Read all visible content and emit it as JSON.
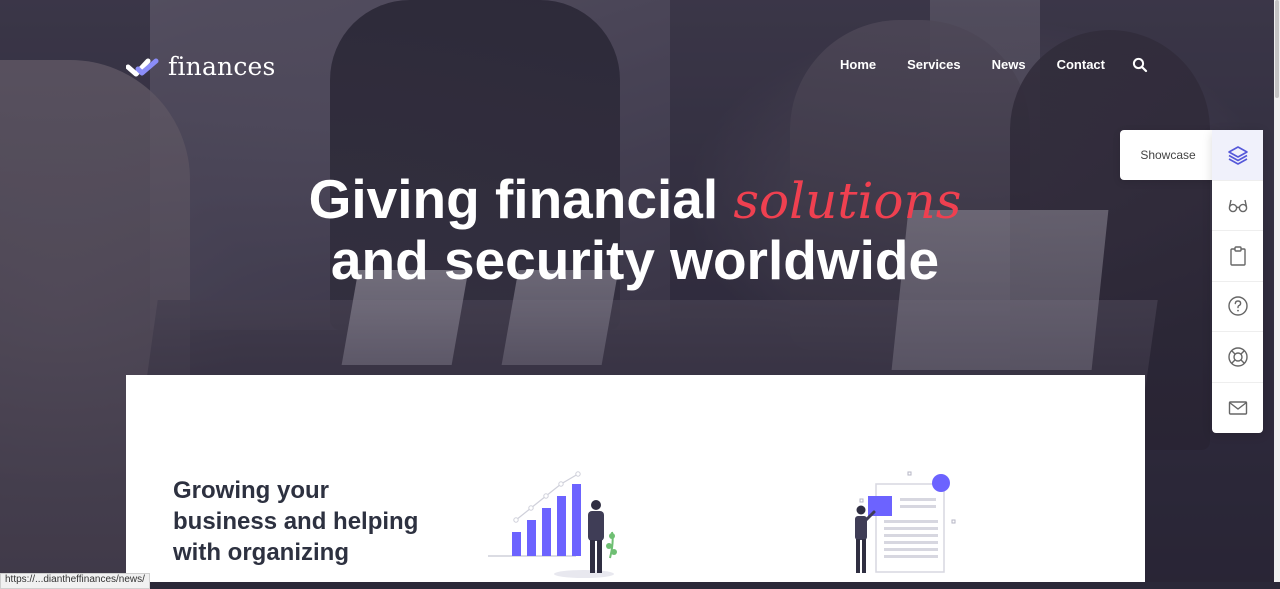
{
  "brand": {
    "name": "finances"
  },
  "nav": {
    "items": [
      "Home",
      "Services",
      "News",
      "Contact"
    ]
  },
  "hero": {
    "line1_before": "Giving financial ",
    "line1_accent": "solutions",
    "line2": "and security worldwide"
  },
  "side_panel": {
    "showcase_label": "Showcase",
    "icons": [
      "layers-icon",
      "glasses-icon",
      "clipboard-icon",
      "help-icon",
      "lifebuoy-icon",
      "mail-icon"
    ]
  },
  "section": {
    "heading_lines": [
      "Growing your",
      "business and helping",
      "with organizing"
    ]
  },
  "status_bar": {
    "url": "https://...diantheffinances/news/"
  },
  "colors": {
    "accent": "#ef4050",
    "brand": "#6b6ef5",
    "heading": "#2d3140"
  }
}
